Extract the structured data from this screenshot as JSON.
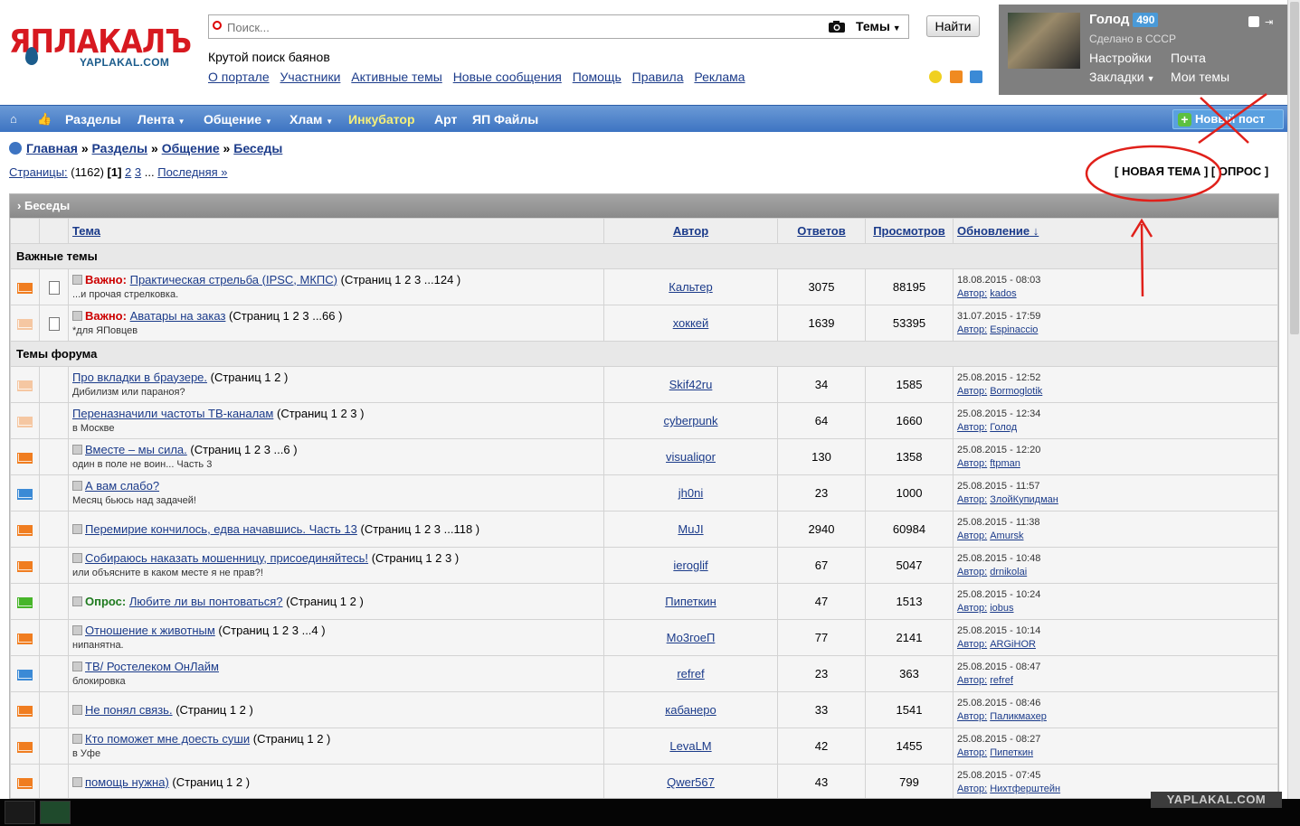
{
  "logo": {
    "main": "ЯПЛАКАЛЪ",
    "sub": "YAPLAKAL.COM"
  },
  "search": {
    "placeholder": "Поиск...",
    "scope": "Темы",
    "button": "Найти"
  },
  "tagline": "Крутой поиск баянов",
  "top_links": [
    "О портале",
    "Участники",
    "Активные темы",
    "Новые сообщения",
    "Помощь",
    "Правила",
    "Реклама"
  ],
  "user": {
    "name": "Голод",
    "count": "490",
    "subtitle": "Сделано в СССР",
    "links": [
      "Настройки",
      "Почта",
      "Закладки",
      "Мои темы"
    ]
  },
  "nav": {
    "items": [
      "Разделы",
      "Лента",
      "Общение",
      "Хлам",
      "Инкубатор",
      "Арт",
      "ЯП Файлы"
    ],
    "new_post": "Новый пост"
  },
  "breadcrumb": [
    "Главная",
    "Разделы",
    "Общение",
    "Беседы"
  ],
  "pages": {
    "label": "Страницы:",
    "count": "(1162)",
    "current": "[1]",
    "p2": "2",
    "p3": "3",
    "dots": "...",
    "last": "Последняя »"
  },
  "actions": {
    "new_topic": "[ НОВАЯ ТЕМА ]",
    "poll": "[ ОПРОС ]"
  },
  "forum": {
    "title": "Беседы"
  },
  "columns": {
    "topic": "Тема",
    "author": "Автор",
    "replies": "Ответов",
    "views": "Просмотров",
    "updated": "Обновление ↓"
  },
  "sections": {
    "important": "Важные темы",
    "forum": "Темы форума"
  },
  "labels": {
    "important": "Важно:",
    "poll": "Опрос:",
    "author": "Автор:"
  },
  "colors": {
    "nav_blue": "#3d74c2",
    "link": "#1b3b8a",
    "important": "#c00000",
    "poll": "#1f7a1f",
    "envelope_orange": "#f07d20",
    "envelope_light": "#f5c7a2",
    "envelope_blue": "#3b8ad6",
    "envelope_green": "#47b52a",
    "annotation_red": "#e0201a"
  },
  "important_topics": [
    {
      "icon": "envelope-orange",
      "prefix": "Важно:",
      "title": "Практическая стрельба (IPSC, МКПС)",
      "pages": "(Страниц 1 2 3 ...124 )",
      "desc": "...и прочая стрелковка.",
      "author": "Кальтер",
      "replies": "3075",
      "views": "88195",
      "date": "18.08.2015 - 08:03",
      "last": "kados"
    },
    {
      "icon": "envelope-light",
      "prefix": "Важно:",
      "title": "Аватары на заказ",
      "pages": "(Страниц 1 2 3 ...66 )",
      "desc": "*для ЯПовцев",
      "author": "хоккей",
      "replies": "1639",
      "views": "53395",
      "date": "31.07.2015 - 17:59",
      "last": "Espinaccio"
    }
  ],
  "topics": [
    {
      "icon": "envelope-light",
      "title": "Про вкладки в браузере.",
      "pages": "(Страниц 1 2 )",
      "desc": "Дибилизм или параноя?",
      "author": "Skif42ru",
      "replies": "34",
      "views": "1585",
      "date": "25.08.2015 - 12:52",
      "last": "Bormoglotik"
    },
    {
      "icon": "envelope-light",
      "title": "Переназначили частоты ТВ-каналам",
      "pages": "(Страниц 1 2 3 )",
      "desc": "в Москве",
      "author": "cyberpunk",
      "replies": "64",
      "views": "1660",
      "date": "25.08.2015 - 12:34",
      "last": "Голод"
    },
    {
      "icon": "envelope-orange",
      "title": "Вместе – мы сила.",
      "pages": "(Страниц 1 2 3 ...6 )",
      "desc": "один в поле не воин... Часть 3",
      "author": "visualiqor",
      "replies": "130",
      "views": "1358",
      "date": "25.08.2015 - 12:20",
      "last": "ftpman"
    },
    {
      "icon": "envelope-blue",
      "title": "А вам слабо?",
      "pages": "",
      "desc": "Месяц бьюсь над задачей!",
      "author": "jh0ni",
      "replies": "23",
      "views": "1000",
      "date": "25.08.2015 - 11:57",
      "last": "ЗлойКупидман"
    },
    {
      "icon": "envelope-orange",
      "title": "Перемирие кончилось, едва начавшись. Часть 13",
      "pages": "(Страниц 1 2 3 ...118 )",
      "desc": "",
      "author": "MuJI",
      "replies": "2940",
      "views": "60984",
      "date": "25.08.2015 - 11:38",
      "last": "Amursk"
    },
    {
      "icon": "envelope-orange",
      "title": "Собираюсь наказать мошенницу, присоединяйтесь!",
      "pages": "(Страниц 1 2 3 )",
      "desc": "или объясните в каком месте я не прав?!",
      "author": "ieroglif",
      "replies": "67",
      "views": "5047",
      "date": "25.08.2015 - 10:48",
      "last": "drnikolai"
    },
    {
      "icon": "envelope-green",
      "prefix": "Опрос:",
      "title": "Любите ли вы понтоваться?",
      "pages": "(Страниц 1 2 )",
      "desc": "",
      "author": "Пипеткин",
      "replies": "47",
      "views": "1513",
      "date": "25.08.2015 - 10:24",
      "last": "iobus"
    },
    {
      "icon": "envelope-orange",
      "title": "Отношение к животным",
      "pages": "(Страниц 1 2 3 ...4 )",
      "desc": "нипанятна.",
      "author": "Мо3гоеП",
      "replies": "77",
      "views": "2141",
      "date": "25.08.2015 - 10:14",
      "last": "ARGiHOR"
    },
    {
      "icon": "envelope-blue",
      "title": "ТВ/ Ростелеком ОнЛайм",
      "pages": "",
      "desc": "блокировка",
      "author": "refref",
      "replies": "23",
      "views": "363",
      "date": "25.08.2015 - 08:47",
      "last": "refref"
    },
    {
      "icon": "envelope-orange",
      "title": "Не понял связь.",
      "pages": "(Страниц 1 2 )",
      "desc": "",
      "author": "кабанеро",
      "replies": "33",
      "views": "1541",
      "date": "25.08.2015 - 08:46",
      "last": "Паликмахер"
    },
    {
      "icon": "envelope-orange",
      "title": "Кто поможет мне доесть суши",
      "pages": "(Страниц 1 2 )",
      "desc": "в Уфе",
      "author": "LevaLM",
      "replies": "42",
      "views": "1455",
      "date": "25.08.2015 - 08:27",
      "last": "Пипеткин"
    },
    {
      "icon": "envelope-orange",
      "title": "помощь нужна)",
      "pages": "(Страниц 1 2 )",
      "desc": "",
      "author": "Qwer567",
      "replies": "43",
      "views": "799",
      "date": "25.08.2015 - 07:45",
      "last": "Нихтферштейн"
    }
  ],
  "watermark": "YAPLAKAL.COM"
}
